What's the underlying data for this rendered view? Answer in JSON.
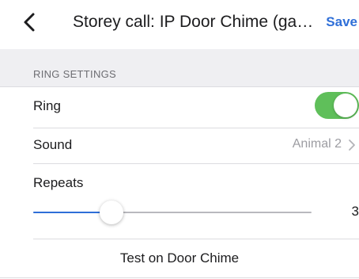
{
  "navbar": {
    "title": "Storey call: IP Door Chime (garden)",
    "save_label": "Save"
  },
  "ring_settings": {
    "header": "RING SETTINGS",
    "ring": {
      "label": "Ring",
      "enabled": true
    },
    "sound": {
      "label": "Sound",
      "value": "Animal 2"
    },
    "repeats": {
      "label": "Repeats",
      "value": "3",
      "level_fraction": 0.24
    }
  },
  "test_button": {
    "label": "Test on Door Chime"
  },
  "colors": {
    "accent": "#2f6fd8",
    "toggle_on": "#5fbf5a",
    "section_bg": "#efeff2"
  }
}
